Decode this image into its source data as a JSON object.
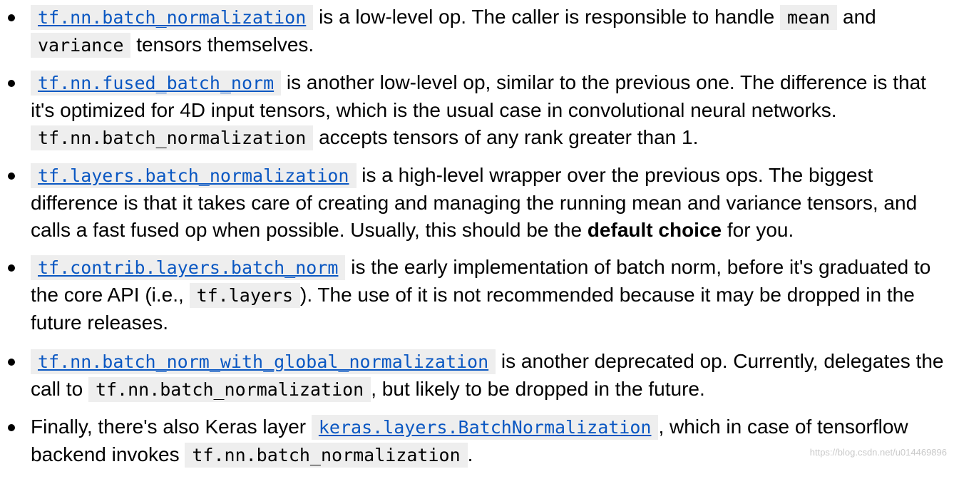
{
  "items": [
    {
      "api": "tf.nn.batch_normalization",
      "t1": " is a low-level op. The caller is responsible to handle ",
      "c1": "mean",
      "t2": " and ",
      "c2": "variance",
      "t3": " tensors themselves."
    },
    {
      "api": "tf.nn.fused_batch_norm",
      "t1": " is another low-level op, similar to the previous one. The difference is that it's optimized for 4D input tensors, which is the usual case in convolutional neural networks. ",
      "c1": "tf.nn.batch_normalization",
      "t2": " accepts tensors of any rank greater than 1."
    },
    {
      "api": "tf.layers.batch_normalization",
      "t1": " is a high-level wrapper over the previous ops. The biggest difference is that it takes care of creating and managing the running mean and variance tensors, and calls a fast fused op when possible. Usually, this should be the ",
      "bold": "default choice",
      "t2": " for you."
    },
    {
      "api": "tf.contrib.layers.batch_norm",
      "t1": " is the early implementation of batch norm, before it's graduated to the core API (i.e., ",
      "c1": "tf.layers",
      "t2": "). The use of it is not recommended because it may be dropped in the future releases."
    },
    {
      "api": "tf.nn.batch_norm_with_global_normalization",
      "t1": " is another deprecated op. Currently, delegates the call to ",
      "c1": "tf.nn.batch_normalization",
      "t2": ", but likely to be dropped in the future."
    },
    {
      "t0": "Finally, there's also Keras layer ",
      "api": "keras.layers.BatchNormalization",
      "t1": ", which in case of tensorflow backend invokes ",
      "c1": "tf.nn.batch_normalization",
      "t2": "."
    }
  ],
  "watermark": "https://blog.csdn.net/u014469896"
}
